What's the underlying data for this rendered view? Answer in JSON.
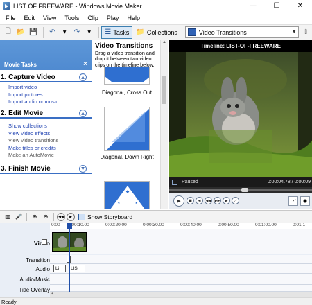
{
  "window": {
    "title": "LIST OF FREEWARE - Windows Movie Maker",
    "minimize_glyph": "—",
    "maximize_glyph": "☐",
    "close_glyph": "✕"
  },
  "menu": [
    "File",
    "Edit",
    "View",
    "Tools",
    "Clip",
    "Play",
    "Help"
  ],
  "toolbar": {
    "tasks_label": "Tasks",
    "collections_label": "Collections",
    "collection_value": "Video Transitions"
  },
  "tasks": {
    "header": "Movie Tasks",
    "steps": [
      {
        "title": "1. Capture Video",
        "links": [
          "Import video",
          "Import pictures",
          "Import audio or music"
        ]
      },
      {
        "title": "2. Edit Movie",
        "links": [
          "Show collections",
          "View video effects",
          "View video transitions",
          "Make titles or credits",
          "Make an AutoMovie"
        ]
      },
      {
        "title": "3. Finish Movie",
        "links": []
      }
    ]
  },
  "transitions": {
    "title": "Video Transitions",
    "description": "Drag a video transition and drop it between two video clips on the timeline below.",
    "items": [
      "Diagonal, Cross Out",
      "Diagonal, Down Right"
    ]
  },
  "monitor": {
    "title": "Timeline: LIST-OF-FREEWARE",
    "status": "Paused",
    "time": "0:00:04.78 / 0:00:09"
  },
  "timeline": {
    "show_storyboard": "Show Storyboard",
    "ruler": [
      "0:00",
      "0:00:10.00",
      "0:00:20.00",
      "0:00:30.00",
      "0:00:40.00",
      "0:00:50.00",
      "0:01:00.00",
      "0:01:1"
    ],
    "tracks": {
      "video": "Video",
      "transition": "Transition",
      "audio": "Audio",
      "audio_music": "Audio/Music",
      "title_overlay": "Title Overlay"
    },
    "audio_clips": [
      "Li",
      "LIS"
    ]
  },
  "status": "Ready",
  "colors": {
    "accent": "#3e7ac6",
    "link": "#1c3fb0",
    "playhead": "#1f4ea8"
  }
}
